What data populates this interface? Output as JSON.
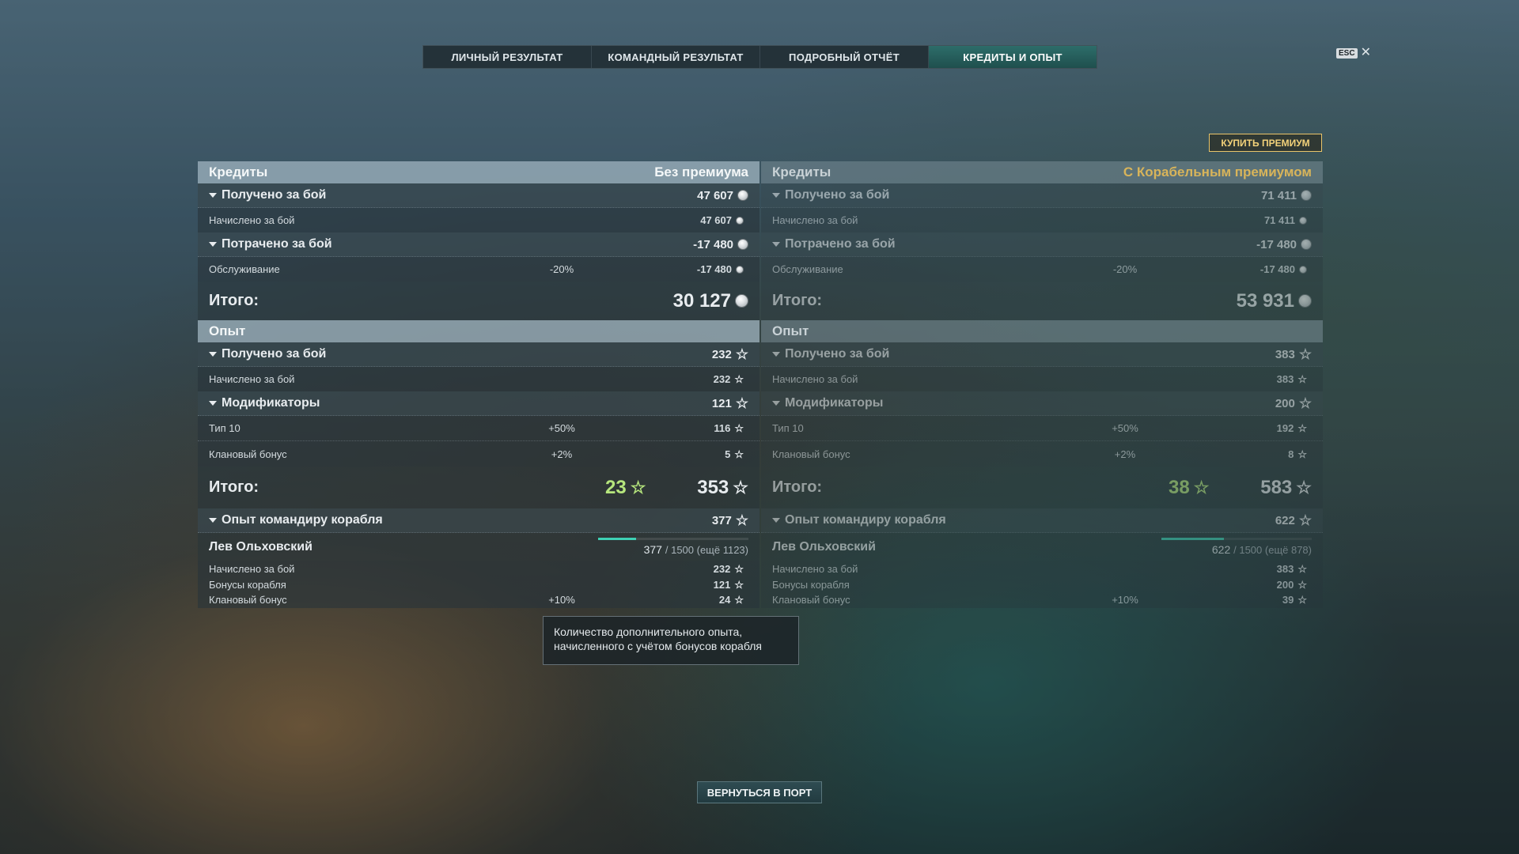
{
  "tabs": [
    "ЛИЧНЫЙ РЕЗУЛЬТАТ",
    "КОМАНДНЫЙ РЕЗУЛЬТАТ",
    "ПОДРОБНЫЙ ОТЧЁТ",
    "КРЕДИТЫ И ОПЫТ"
  ],
  "active_tab": "КРЕДИТЫ И ОПЫТ",
  "esc_label": "ESC",
  "buy_premium": "КУПИТЬ ПРЕМИУМ",
  "left": {
    "credits_title": "Кредиты",
    "credits_subtitle": "Без премиума",
    "earned_label": "Получено за бой",
    "earned_value": "47 607",
    "accrued_label": "Начислено за бой",
    "accrued_value": "47 607",
    "spent_label": "Потрачено за бой",
    "spent_value": "-17 480",
    "service_label": "Обслуживание",
    "service_pct": "-20%",
    "service_value": "-17 480",
    "credits_total_label": "Итого:",
    "credits_total": "30 127",
    "xp_title": "Опыт",
    "xp_earned_label": "Получено за бой",
    "xp_earned_value": "232",
    "xp_accrued_label": "Начислено за бой",
    "xp_accrued_value": "232",
    "mods_label": "Модификаторы",
    "mods_value": "121",
    "tier_label": "Тип 10",
    "tier_pct": "+50%",
    "tier_value": "116",
    "clan_label": "Клановый бонус",
    "clan_pct": "+2%",
    "clan_value": "5",
    "xp_total_label": "Итого:",
    "xp_free": "23",
    "xp_total": "353",
    "cmdr_xp_label": "Опыт командиру корабля",
    "cmdr_xp_value": "377",
    "cmdr_name": "Лев Ольховский",
    "cmdr_progress_value": "377",
    "cmdr_progress_rest": "/ 1500 (ещё 1123)",
    "cmdr_progress_fraction": 0.251,
    "cmdr_accrued_label": "Начислено за бой",
    "cmdr_accrued_value": "232",
    "cmdr_ship_label": "Бонусы корабля",
    "cmdr_ship_value": "121",
    "cmdr_clan_label": "Клановый бонус",
    "cmdr_clan_pct": "+10%",
    "cmdr_clan_value": "24"
  },
  "right": {
    "credits_title": "Кредиты",
    "credits_subtitle": "С Корабельным премиумом",
    "earned_label": "Получено за бой",
    "earned_value": "71 411",
    "accrued_label": "Начислено за бой",
    "accrued_value": "71 411",
    "spent_label": "Потрачено за бой",
    "spent_value": "-17 480",
    "service_label": "Обслуживание",
    "service_pct": "-20%",
    "service_value": "-17 480",
    "credits_total_label": "Итого:",
    "credits_total": "53 931",
    "xp_title": "Опыт",
    "xp_earned_label": "Получено за бой",
    "xp_earned_value": "383",
    "xp_accrued_label": "Начислено за бой",
    "xp_accrued_value": "383",
    "mods_label": "Модификаторы",
    "mods_value": "200",
    "tier_label": "Тип 10",
    "tier_pct": "+50%",
    "tier_value": "192",
    "clan_label": "Клановый бонус",
    "clan_pct": "+2%",
    "clan_value": "8",
    "xp_total_label": "Итого:",
    "xp_free": "38",
    "xp_total": "583",
    "cmdr_xp_label": "Опыт командиру корабля",
    "cmdr_xp_value": "622",
    "cmdr_name": "Лев Ольховский",
    "cmdr_progress_value": "622",
    "cmdr_progress_rest": "/ 1500 (ещё 878)",
    "cmdr_progress_fraction": 0.415,
    "cmdr_accrued_label": "Начислено за бой",
    "cmdr_accrued_value": "383",
    "cmdr_ship_label": "Бонусы корабля",
    "cmdr_ship_value": "200",
    "cmdr_clan_label": "Клановый бонус",
    "cmdr_clan_pct": "+10%",
    "cmdr_clan_value": "39"
  },
  "tooltip": "Количество дополнительного опыта, начисленного с учётом бонусов корабля",
  "return_button": "ВЕРНУТЬСЯ В ПОРТ",
  "colors": {
    "accent_teal": "#3ed0b4",
    "premium_gold": "#d8b45a",
    "free_xp_green": "#b6e67d"
  },
  "icons": {
    "credits": "credit-coin-icon",
    "xp": "star-icon",
    "expand": "triangle-down-icon",
    "close": "close-icon"
  }
}
